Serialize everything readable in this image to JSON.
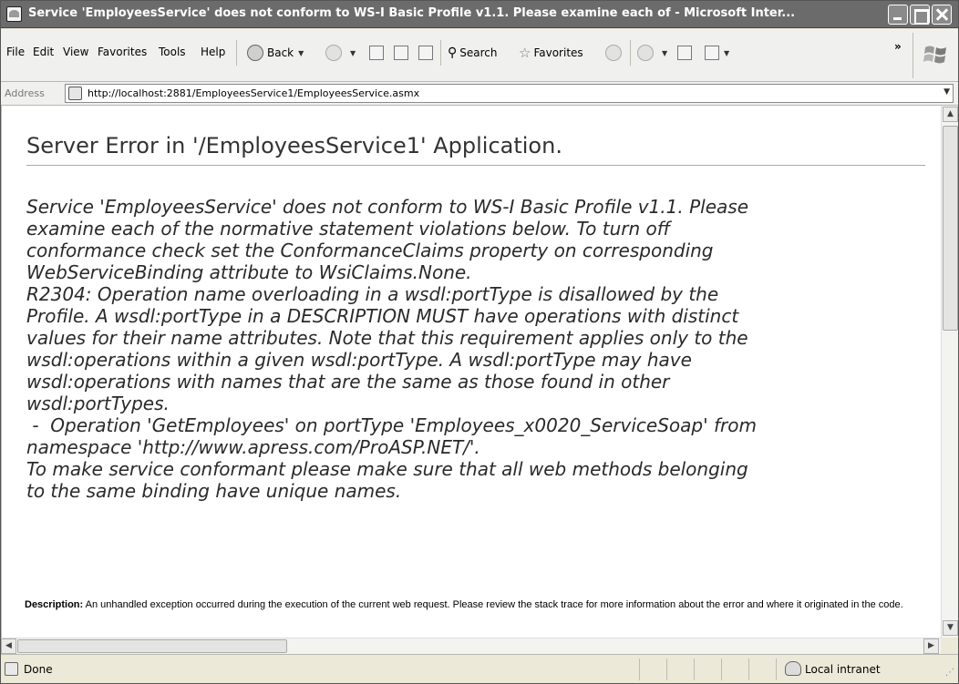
{
  "window": {
    "title": "Service 'EmployeesService' does not conform to WS-I Basic Profile v1.1. Please examine each of  - Microsoft Inter..."
  },
  "menu": {
    "items": [
      "File",
      "Edit",
      "View",
      "Favorites",
      "Tools",
      "Help"
    ]
  },
  "toolbar": {
    "back_label": "Back",
    "search_label": "Search",
    "favorites_label": "Favorites",
    "more_label": "»"
  },
  "address": {
    "label": "Address",
    "url": "http://localhost:2881/EmployeesService1/EmployeesService.asmx"
  },
  "page": {
    "title": "Server Error in '/EmployeesService1' Application.",
    "error_lines": [
      "Service 'EmployeesService' does not conform to WS-I Basic Profile v1.1. Please",
      "examine each of the normative statement violations below. To turn off",
      "conformance check set the ConformanceClaims property on corresponding",
      "WebServiceBinding attribute to WsiClaims.None.",
      "R2304: Operation name overloading in a wsdl:portType is disallowed by the",
      "Profile. A wsdl:portType in a DESCRIPTION MUST have operations with distinct",
      "values for their name attributes. Note that this requirement applies only to the",
      "wsdl:operations within a given wsdl:portType. A wsdl:portType may have",
      "wsdl:operations with names that are the same as those found in other",
      "wsdl:portTypes.",
      " -  Operation 'GetEmployees' on portType 'Employees_x0020_ServiceSoap' from",
      "namespace 'http://www.apress.com/ProASP.NET/'.",
      "To make service conformant please make sure that all web methods belonging",
      "to the same binding have unique names."
    ],
    "description_label": "Description:",
    "description_text": " An unhandled exception occurred during the execution of the current web request. Please review the stack trace for more information about the error and where it originated in the code."
  },
  "status": {
    "text": "Done",
    "zone": "Local intranet"
  }
}
